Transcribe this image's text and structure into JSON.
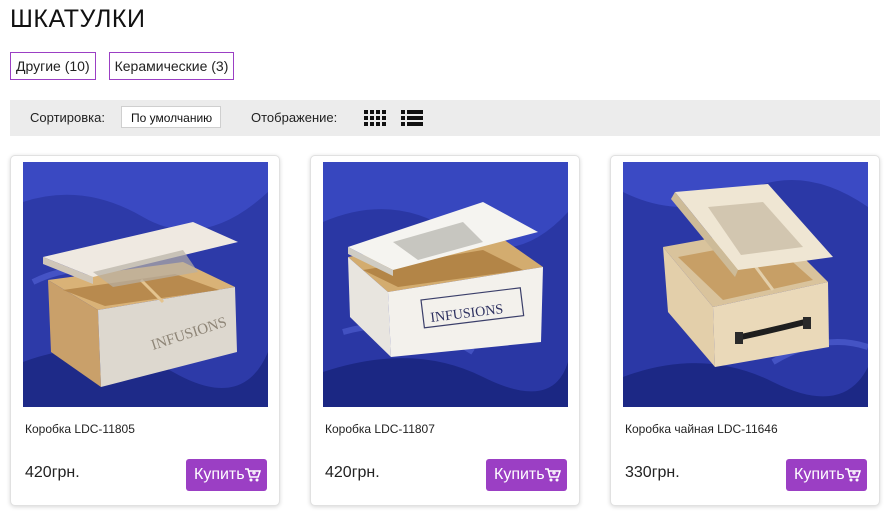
{
  "page": {
    "title": "ШКАТУЛКИ"
  },
  "categories": [
    {
      "label": "Другие (10)"
    },
    {
      "label": "Керамические (3)"
    }
  ],
  "toolbar": {
    "sort_label": "Сортировка:",
    "sort_value": "По умолчанию",
    "view_label": "Отображение:",
    "view_modes": [
      "grid-icon",
      "list-icon"
    ]
  },
  "buy_label": "Купить",
  "products": [
    {
      "name": "Коробка LDC-11805",
      "price": "420грн.",
      "image_label": "INFUSIONS"
    },
    {
      "name": "Коробка LDC-11807",
      "price": "420грн.",
      "image_label": "INFUSIONS"
    },
    {
      "name": "Коробка чайная LDC-11646",
      "price": "330грн."
    }
  ],
  "colors": {
    "accent": "#9b3fc4",
    "toolbar_bg": "#ececec",
    "image_background": "#2d3aa8"
  }
}
